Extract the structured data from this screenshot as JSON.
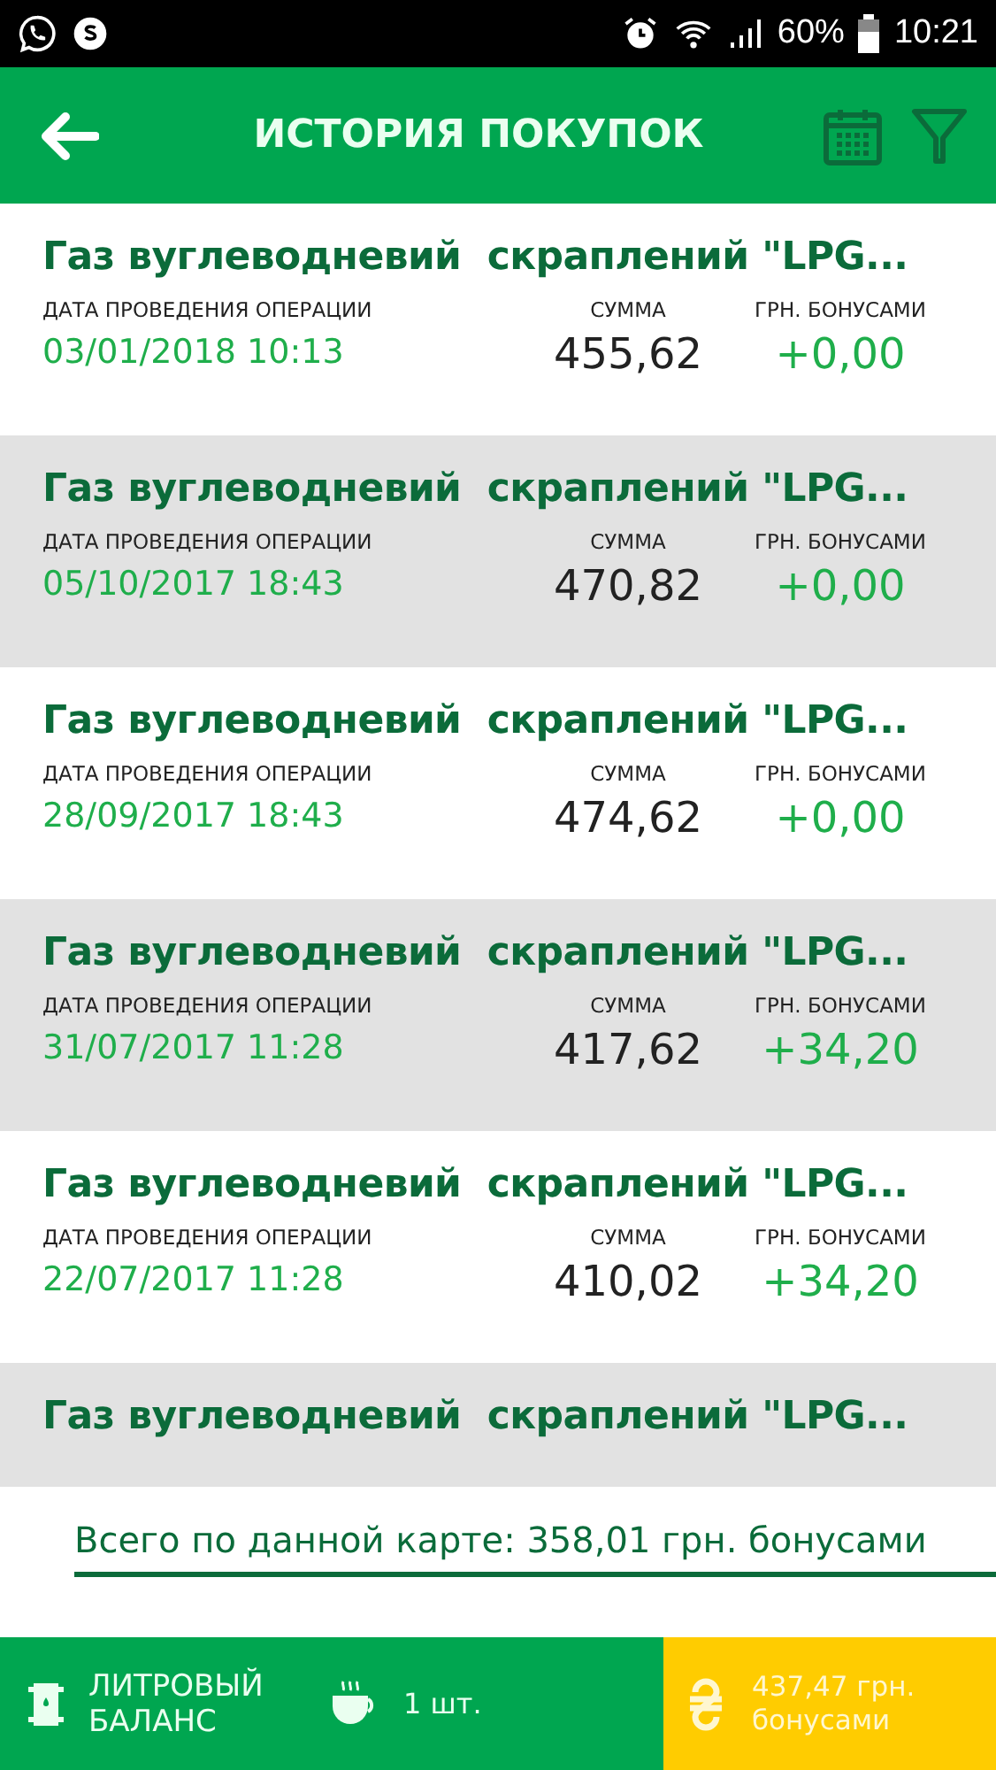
{
  "status_bar": {
    "battery": "60%",
    "time": "10:21"
  },
  "header": {
    "title": "ИСТОРИЯ ПОКУПОК"
  },
  "rows": [
    {
      "title": "Газ вуглеводневий  скраплений \"LPG...",
      "date_label": "ДАТА ПРОВЕДЕНИЯ ОПЕРАЦИИ",
      "date": "03/01/2018 10:13",
      "sum_label": "СУММА",
      "sum": "455,62",
      "bonus_label": "ГРН. БОНУСАМИ",
      "bonus": "+0,00"
    },
    {
      "title": "Газ вуглеводневий  скраплений \"LPG...",
      "date_label": "ДАТА ПРОВЕДЕНИЯ ОПЕРАЦИИ",
      "date": "05/10/2017 18:43",
      "sum_label": "СУММА",
      "sum": "470,82",
      "bonus_label": "ГРН. БОНУСАМИ",
      "bonus": "+0,00"
    },
    {
      "title": "Газ вуглеводневий  скраплений \"LPG...",
      "date_label": "ДАТА ПРОВЕДЕНИЯ ОПЕРАЦИИ",
      "date": "28/09/2017 18:43",
      "sum_label": "СУММА",
      "sum": "474,62",
      "bonus_label": "ГРН. БОНУСАМИ",
      "bonus": "+0,00"
    },
    {
      "title": "Газ вуглеводневий  скраплений \"LPG...",
      "date_label": "ДАТА ПРОВЕДЕНИЯ ОПЕРАЦИИ",
      "date": "31/07/2017 11:28",
      "sum_label": "СУММА",
      "sum": "417,62",
      "bonus_label": "ГРН. БОНУСАМИ",
      "bonus": "+34,20"
    },
    {
      "title": "Газ вуглеводневий  скраплений \"LPG...",
      "date_label": "ДАТА ПРОВЕДЕНИЯ ОПЕРАЦИИ",
      "date": "22/07/2017 11:28",
      "sum_label": "СУММА",
      "sum": "410,02",
      "bonus_label": "ГРН. БОНУСАМИ",
      "bonus": "+34,20"
    },
    {
      "title": "Газ вуглеводневий  скраплений \"LPG..."
    }
  ],
  "total": "Всего по данной карте: 358,01 грн. бонусами",
  "footer": {
    "liters_label": "ЛИТРОВЫЙ БАЛАНС",
    "cups": "1 шт.",
    "bonus_line1": "437,47 грн.",
    "bonus_line2": "бонусами"
  }
}
